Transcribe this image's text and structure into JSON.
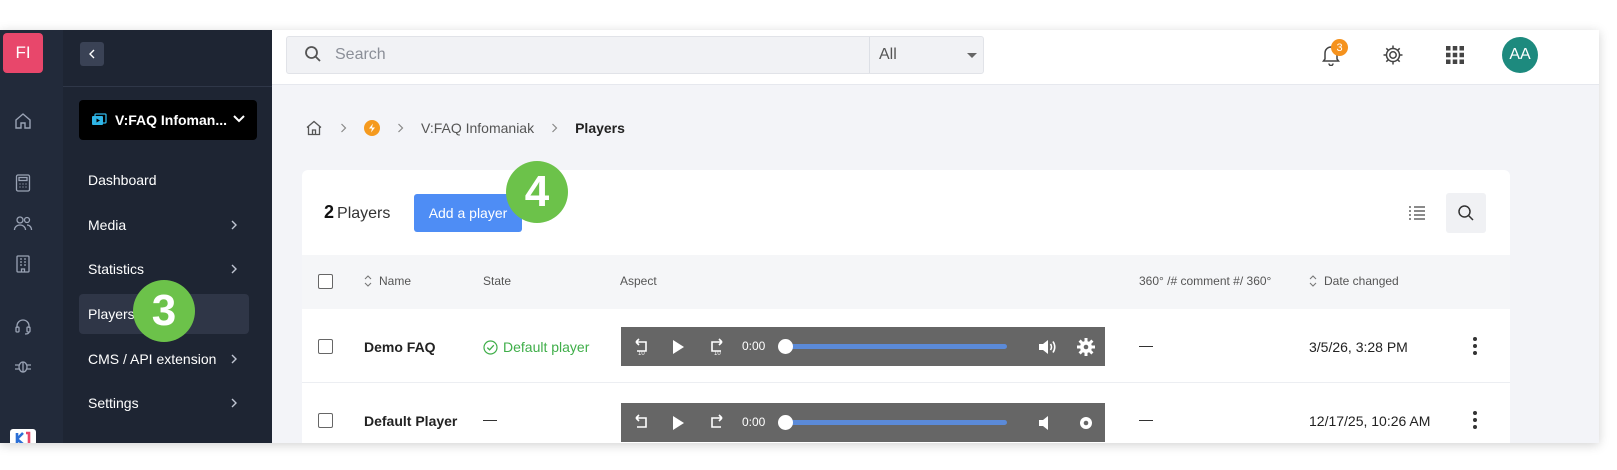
{
  "app": {
    "logo_text": "FI"
  },
  "rail": {
    "icons": [
      "home-icon",
      "calculator-icon",
      "users-icon",
      "building-icon",
      "headset-icon",
      "bug-icon"
    ]
  },
  "sidebar": {
    "channel_label": "V:FAQ Infoman...",
    "items": [
      {
        "label": "Dashboard",
        "has_chevron": false
      },
      {
        "label": "Media",
        "has_chevron": true
      },
      {
        "label": "Statistics",
        "has_chevron": true
      },
      {
        "label": "Players",
        "has_chevron": false,
        "active": true
      },
      {
        "label": "CMS / API extension",
        "has_chevron": true
      },
      {
        "label": "Settings",
        "has_chevron": true
      }
    ]
  },
  "topbar": {
    "search_placeholder": "Search",
    "scope_value": "All",
    "notification_count": "3",
    "avatar_initials": "AA"
  },
  "breadcrumb": {
    "channel": "V:FAQ Infomaniak",
    "current": "Players"
  },
  "players_panel": {
    "count": "2",
    "count_label": "Players",
    "add_button": "Add a player",
    "columns": {
      "name": "Name",
      "state": "State",
      "aspect": "Aspect",
      "comment": "360° /# comment #/ 360°",
      "date": "Date changed"
    },
    "rows": [
      {
        "name": "Demo FAQ",
        "state": "Default player",
        "comment": "—",
        "date": "3/5/26, 3:28 PM",
        "time": "0:00"
      },
      {
        "name": "Default Player",
        "state": "—",
        "comment": "—",
        "date": "12/17/25, 10:26 AM",
        "time": "0:00"
      }
    ]
  },
  "annotations": {
    "step3": "3",
    "step4": "4"
  },
  "colors": {
    "accent": "#4e8df5",
    "logo": "#e8476b",
    "sidebar": "#1e2533",
    "success": "#3fae49",
    "badge": "#f5921d",
    "step": "#6cc24a"
  }
}
